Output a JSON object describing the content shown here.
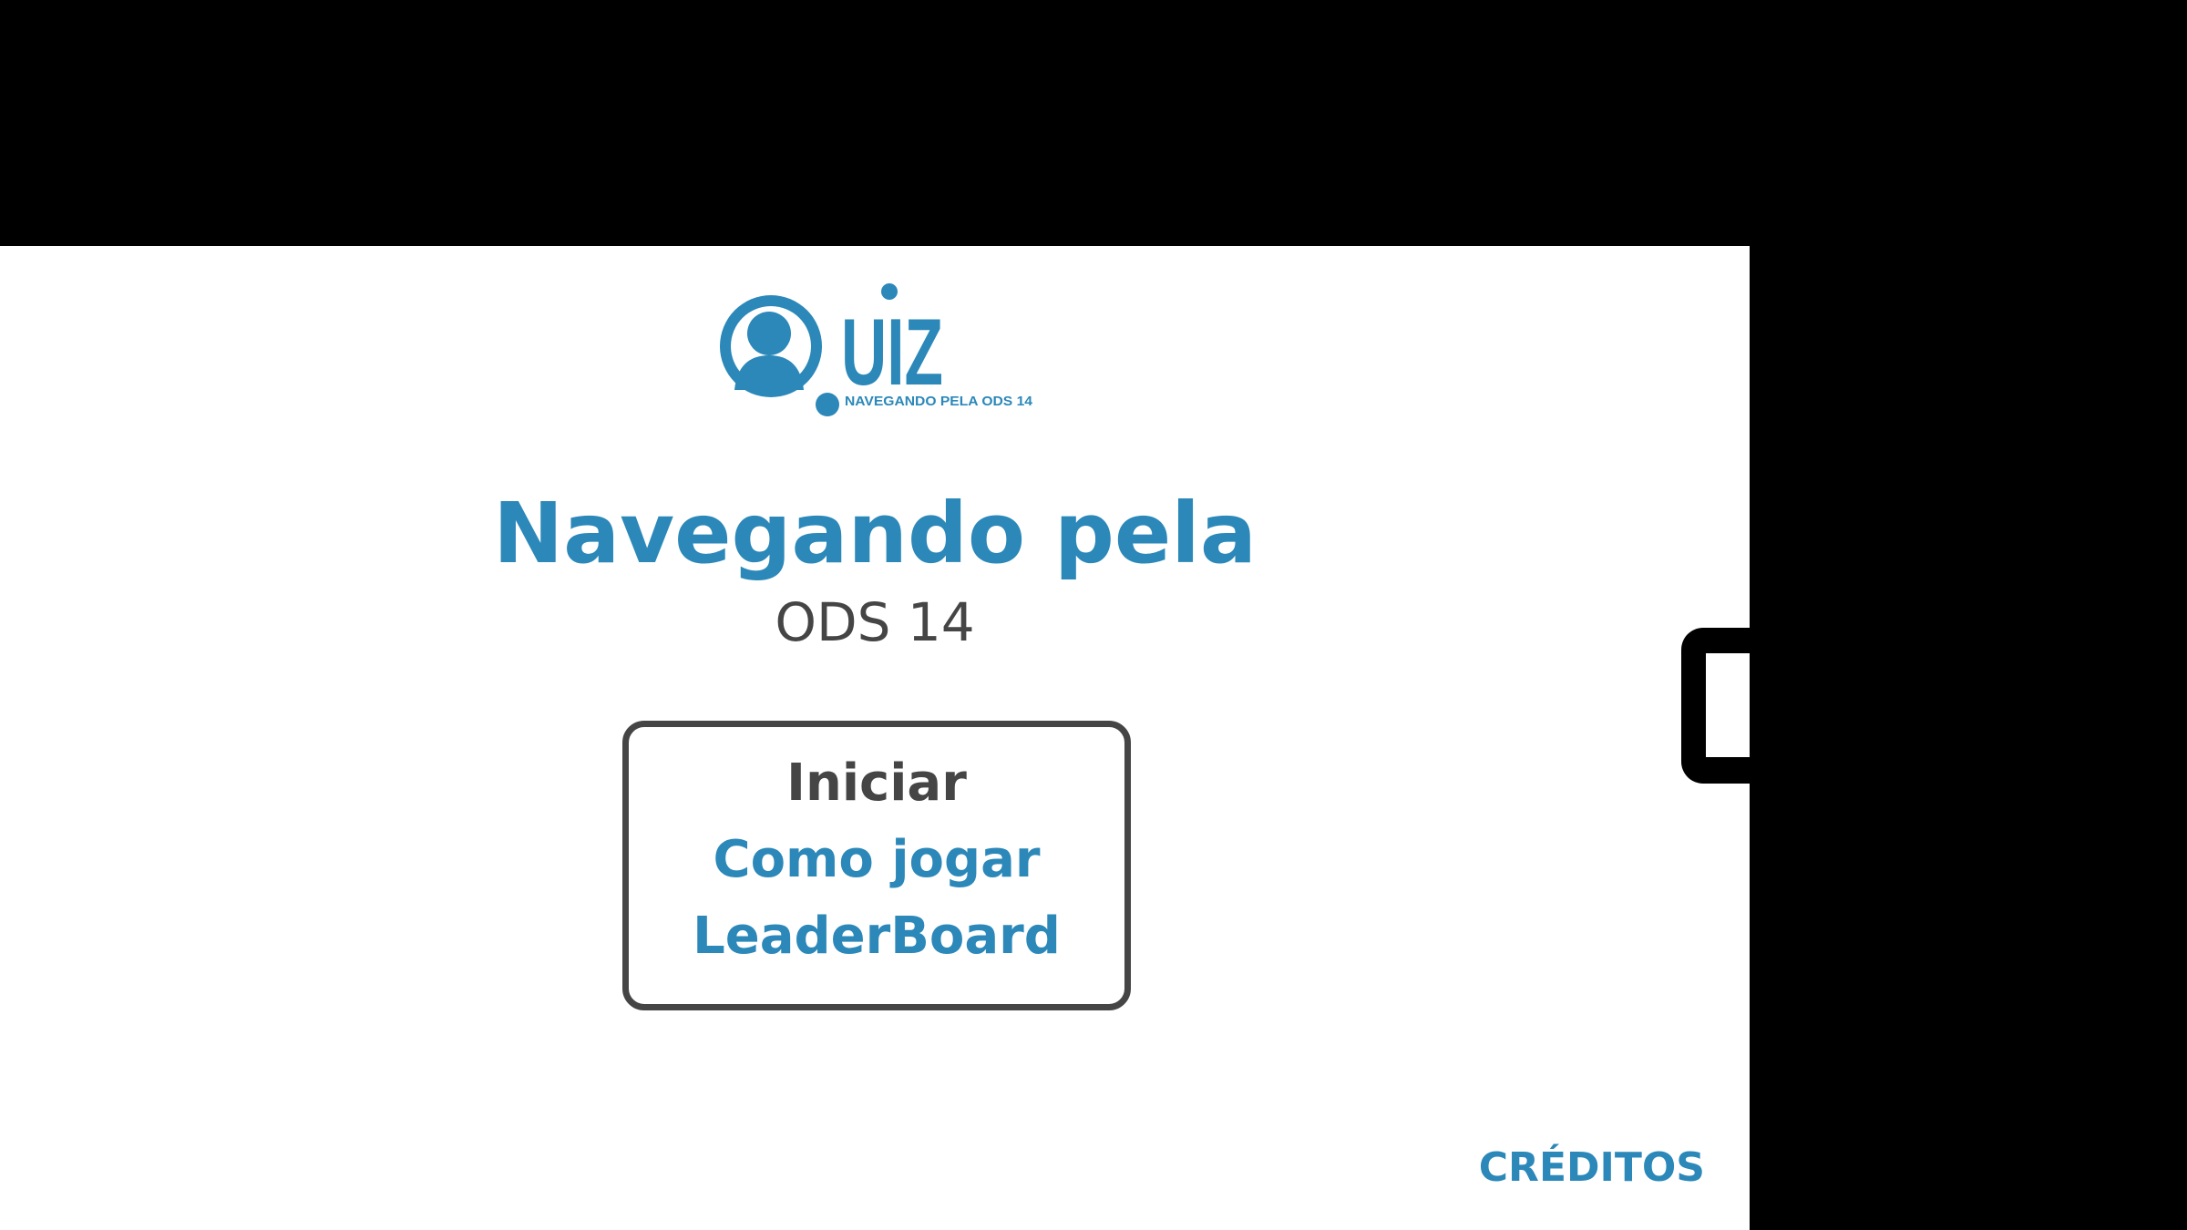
{
  "logo": {
    "wordmark": "QUIZ",
    "tagline": "NAVEGANDO PELA ODS 14"
  },
  "title": {
    "line1": "Navegando pela",
    "line2": "ODS 14"
  },
  "menu": {
    "start_label": "Iniciar",
    "how_to_play_label": "Como jogar",
    "leaderboard_label": "LeaderBoard"
  },
  "credits_label": "CRÉDITOS",
  "colors": {
    "brand_blue": "#2b88b9",
    "dark_gray": "#454545",
    "background": "#ffffff",
    "letterbox": "#000000"
  }
}
